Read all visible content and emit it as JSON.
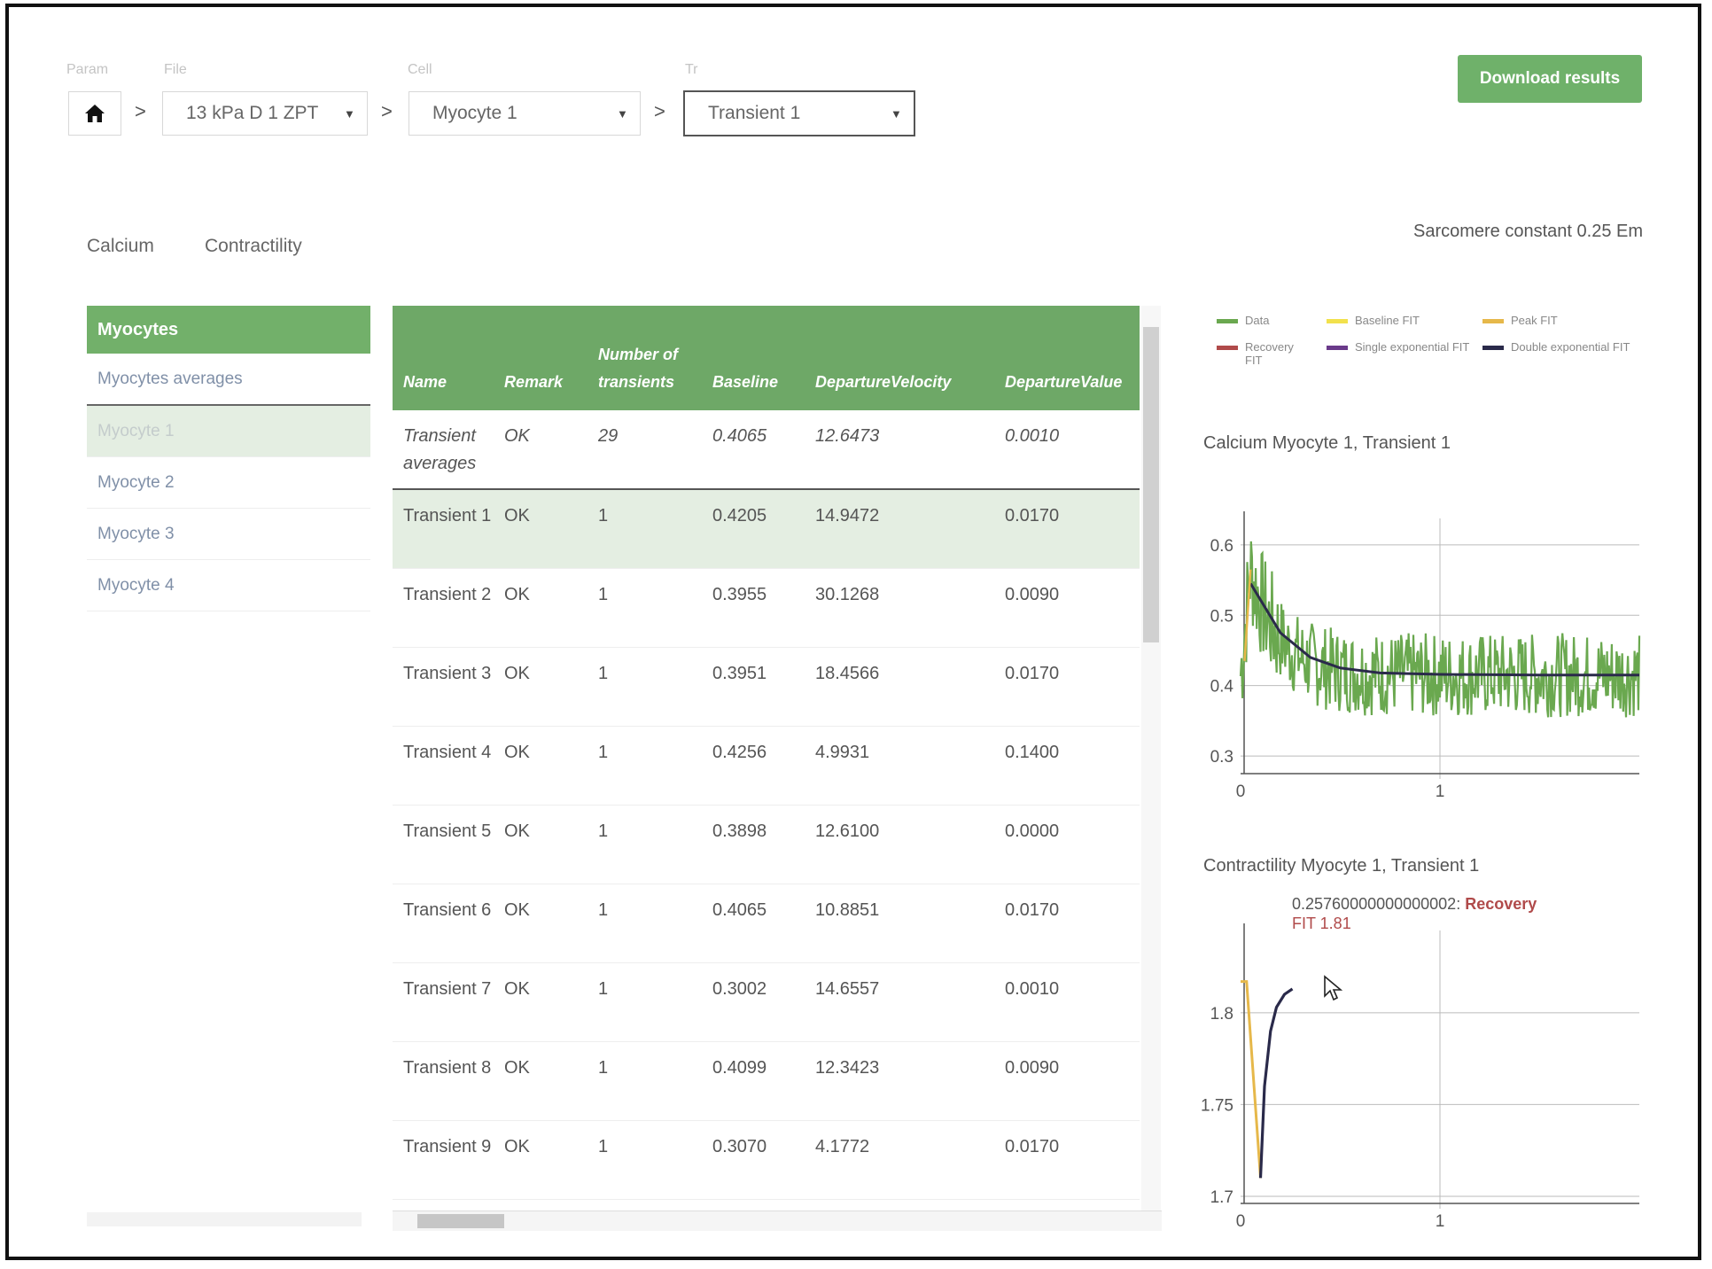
{
  "breadcrumb": {
    "labels": [
      "Param",
      "File",
      "Cell",
      "Tr"
    ],
    "file": "13 kPa D 1 ZPT",
    "cell": "Myocyte 1",
    "transient": "Transient 1",
    "separator": ">"
  },
  "download_label": "Download results",
  "tabs": [
    "Calcium",
    "Contractility"
  ],
  "sarcomere": "Sarcomere constant 0.25 Em",
  "sidebar": {
    "header": "Myocytes",
    "items": [
      "Myocytes averages",
      "Myocyte 1",
      "Myocyte 2",
      "Myocyte 3",
      "Myocyte 4"
    ]
  },
  "table": {
    "headers": [
      "Name",
      "Remark",
      "Number of transients",
      "Baseline",
      "DepartureVelocity",
      "DepartureValue"
    ],
    "rows": [
      [
        "Transient averages",
        "OK",
        "29",
        "0.4065",
        "12.6473",
        "0.0010"
      ],
      [
        "Transient 1",
        "OK",
        "1",
        "0.4205",
        "14.9472",
        "0.0170"
      ],
      [
        "Transient 2",
        "OK",
        "1",
        "0.3955",
        "30.1268",
        "0.0090"
      ],
      [
        "Transient 3",
        "OK",
        "1",
        "0.3951",
        "18.4566",
        "0.0170"
      ],
      [
        "Transient 4",
        "OK",
        "1",
        "0.4256",
        "4.9931",
        "0.1400"
      ],
      [
        "Transient 5",
        "OK",
        "1",
        "0.3898",
        "12.6100",
        "0.0000"
      ],
      [
        "Transient 6",
        "OK",
        "1",
        "0.4065",
        "10.8851",
        "0.0170"
      ],
      [
        "Transient 7",
        "OK",
        "1",
        "0.3002",
        "14.6557",
        "0.0010"
      ],
      [
        "Transient 8",
        "OK",
        "1",
        "0.4099",
        "12.3423",
        "0.0090"
      ],
      [
        "Transient 9",
        "OK",
        "1",
        "0.3070",
        "4.1772",
        "0.0170"
      ]
    ]
  },
  "legend": [
    {
      "label": "Data",
      "color": "#6aa84f"
    },
    {
      "label": "Baseline FIT",
      "color": "#f2e14c"
    },
    {
      "label": "Peak FIT",
      "color": "#e6b84a"
    },
    {
      "label": "Recovery FIT",
      "color": "#b04a4a"
    },
    {
      "label": "Single exponential FIT",
      "color": "#6a3a8a"
    },
    {
      "label": "Double exponential FIT",
      "color": "#2a2a4a"
    }
  ],
  "chart_data": [
    {
      "type": "line",
      "title": "Calcium Myocyte 1, Transient 1",
      "xlabel": "",
      "ylabel": "",
      "xlim": [
        0,
        2
      ],
      "ylim": [
        0.28,
        0.62
      ],
      "yticks": [
        "0.6",
        "0.5",
        "0.4",
        "0.3"
      ],
      "xticks": [
        "0",
        "1"
      ],
      "grid": true,
      "series": [
        {
          "name": "Data",
          "note": "noisy decay from ~0.56 at x=0.05 to ~0.41 baseline"
        },
        {
          "name": "Double exponential FIT",
          "x": [
            0.05,
            0.2,
            0.35,
            0.5,
            0.7,
            1.0,
            1.5,
            2.0
          ],
          "y": [
            0.54,
            0.47,
            0.435,
            0.42,
            0.413,
            0.411,
            0.41,
            0.41
          ]
        }
      ]
    },
    {
      "type": "line",
      "title": "Contractility Myocyte 1, Transient 1",
      "xlabel": "",
      "ylabel": "",
      "xlim": [
        0,
        2
      ],
      "ylim": [
        1.7,
        1.84
      ],
      "yticks": [
        "1.8",
        "1.75",
        "1.7"
      ],
      "xticks": [
        "0",
        "1"
      ],
      "grid": true,
      "annotation": "0.25760000000000002: Recovery FIT 1.81",
      "series": [
        {
          "name": "Peak FIT",
          "x": [
            0,
            0.03,
            0.1
          ],
          "y": [
            1.817,
            1.817,
            1.71
          ]
        },
        {
          "name": "Double exponential FIT",
          "x": [
            0.1,
            0.12,
            0.15,
            0.18,
            0.22,
            0.26
          ],
          "y": [
            1.71,
            1.76,
            1.79,
            1.803,
            1.81,
            1.813
          ]
        }
      ]
    }
  ]
}
